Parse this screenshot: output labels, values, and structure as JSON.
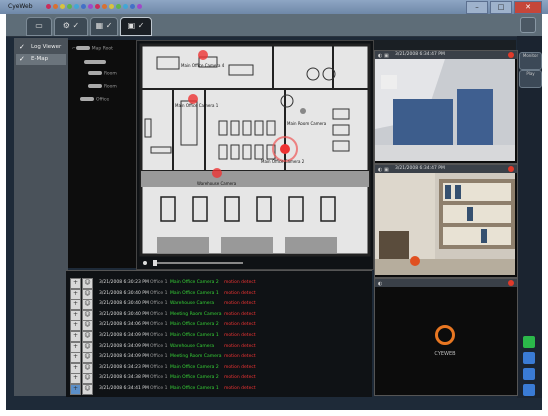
{
  "app": {
    "title": "CyeWeb"
  },
  "colors": {
    "frame": "#1e2a38",
    "toolbar": "#5e6d78",
    "camera_name": "#37d437",
    "event_type": "#e33333",
    "accent": "#e03a2a"
  },
  "toolbar": {
    "tabs": [
      {
        "icon": "monitor-icon"
      },
      {
        "icon": "settings-icon"
      },
      {
        "icon": "layout-icon"
      },
      {
        "icon": "map-icon"
      }
    ]
  },
  "nav": {
    "items": [
      {
        "label": "Log Viewer"
      },
      {
        "label": "E-Map"
      }
    ]
  },
  "tree": {
    "items": [
      {
        "label": "Map Root"
      },
      {
        "label": "Room"
      },
      {
        "label": "Room"
      },
      {
        "label": "Office"
      }
    ]
  },
  "map": {
    "labels": [
      {
        "text": "Main Office Camera 4"
      },
      {
        "text": "Main Office Camera 1"
      },
      {
        "text": "Main Room Camera"
      },
      {
        "text": "Main Office Camera 2"
      },
      {
        "text": "Warehouse Camera"
      }
    ]
  },
  "events": [
    {
      "time": "3/21/2008 6:30:23 PM",
      "office": "Office 1",
      "camera": "Main Office Camera 2",
      "type": "motion detect"
    },
    {
      "time": "3/21/2008 6:30:40 PM",
      "office": "Office 1",
      "camera": "Main Office Camera 1",
      "type": "motion detect"
    },
    {
      "time": "3/21/2008 6:30:40 PM",
      "office": "Office 1",
      "camera": "Warehouse Camera",
      "type": "motion detect"
    },
    {
      "time": "3/21/2008 6:30:40 PM",
      "office": "Office 1",
      "camera": "Meeting Room Camera",
      "type": "motion detect"
    },
    {
      "time": "3/21/2008 6:34:06 PM",
      "office": "Office 1",
      "camera": "Main Office Camera 2",
      "type": "motion detect"
    },
    {
      "time": "3/21/2008 6:34:09 PM",
      "office": "Office 1",
      "camera": "Main Office Camera 1",
      "type": "motion detect"
    },
    {
      "time": "3/21/2008 6:34:09 PM",
      "office": "Office 1",
      "camera": "Warehouse Camera",
      "type": "motion detect"
    },
    {
      "time": "3/21/2008 6:34:09 PM",
      "office": "Office 1",
      "camera": "Meeting Room Camera",
      "type": "motion detect"
    },
    {
      "time": "3/21/2008 6:34:23 PM",
      "office": "Office 1",
      "camera": "Main Office Camera 2",
      "type": "motion detect"
    },
    {
      "time": "3/21/2008 6:34:38 PM",
      "office": "Office 1",
      "camera": "Main Office Camera 2",
      "type": "motion detect"
    },
    {
      "time": "3/21/2008 6:34:41 PM",
      "office": "Office 1",
      "camera": "Main Office Camera 1",
      "type": "motion detect"
    }
  ],
  "cameras": [
    {
      "timestamp": "3/21/2008 6:34:47 PM"
    },
    {
      "timestamp": "3/21/2008 6:34:47 PM"
    },
    {
      "timestamp": "",
      "logo_text": "CYEWEB"
    }
  ],
  "rail": {
    "buttons": [
      {
        "label": "Monitor"
      },
      {
        "label": "Play"
      }
    ]
  }
}
